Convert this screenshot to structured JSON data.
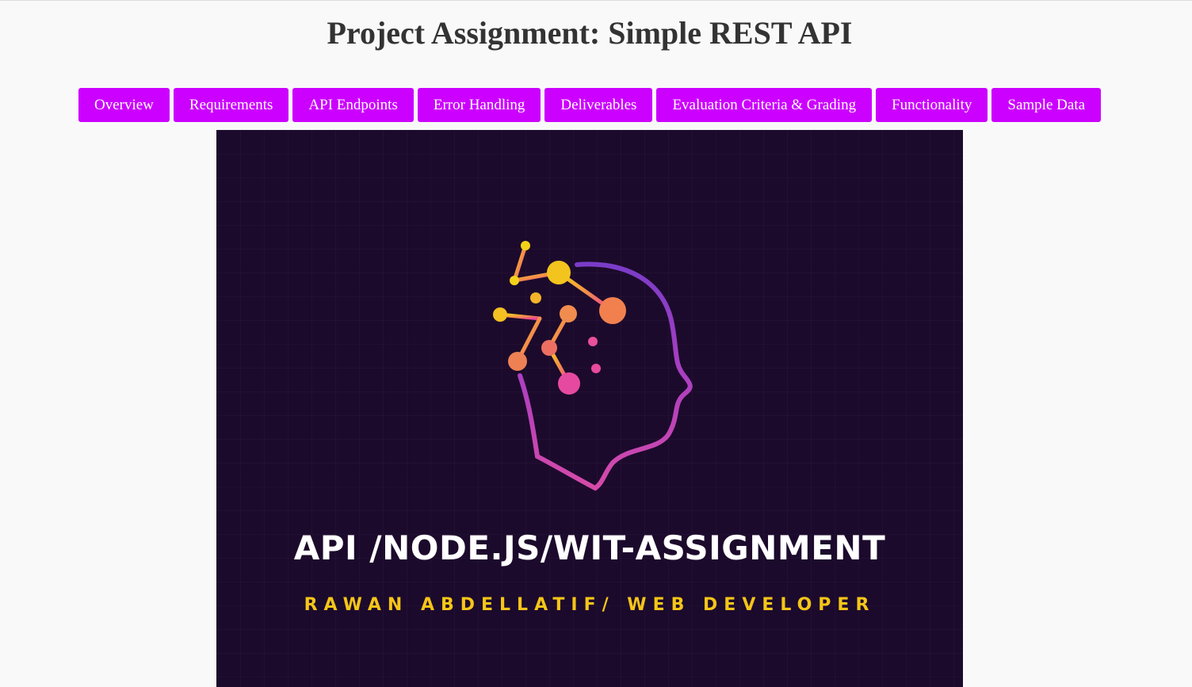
{
  "page": {
    "title": "Project Assignment: Simple REST API"
  },
  "nav": {
    "items": [
      {
        "label": "Overview"
      },
      {
        "label": "Requirements"
      },
      {
        "label": "API Endpoints"
      },
      {
        "label": "Error Handling"
      },
      {
        "label": "Deliverables"
      },
      {
        "label": "Evaluation Criteria & Grading"
      },
      {
        "label": "Functionality"
      },
      {
        "label": "Sample Data"
      }
    ]
  },
  "banner": {
    "title": "API /NODE.JS/WIT-ASSIGNMENT",
    "subtitle": "RAWAN ABDELLATIF/ WEB DEVELOPER",
    "logo_icon": "ai-head-circuit-icon"
  },
  "colors": {
    "background": "#f9f9f9",
    "nav_button": "#cc00ff",
    "banner_background": "#1c0a2c",
    "banner_title": "#ffffff",
    "banner_subtitle": "#f5c518"
  }
}
